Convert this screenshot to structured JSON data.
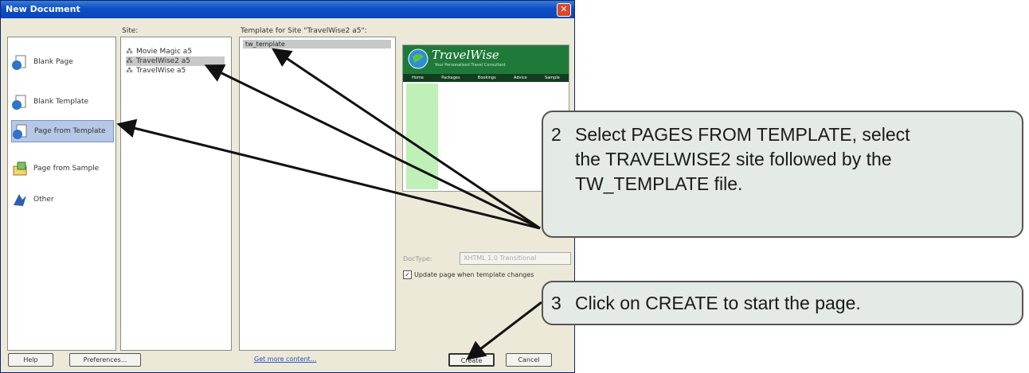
{
  "dialog": {
    "title": "New Document",
    "categories": [
      {
        "label": "Blank Page",
        "icon": "blank-page-icon",
        "selected": false
      },
      {
        "label": "Blank Template",
        "icon": "blank-template-icon",
        "selected": false
      },
      {
        "label": "Page from Template",
        "icon": "page-from-template-icon",
        "selected": true
      },
      {
        "label": "Page from Sample",
        "icon": "page-from-sample-icon",
        "selected": false
      },
      {
        "label": "Other",
        "icon": "other-icon",
        "selected": false
      }
    ],
    "site_label": "Site:",
    "sites": [
      {
        "label": "Movie Magic a5",
        "selected": false
      },
      {
        "label": "TravelWise2 a5",
        "selected": true
      },
      {
        "label": "TravelWise a5",
        "selected": false
      }
    ],
    "template_label": "Template for Site \"TravelWise2 a5\":",
    "templates": [
      {
        "label": "tw_template",
        "selected": true
      }
    ],
    "preview": {
      "logo": "TravelWise",
      "tagline": "Your Personalised Travel Consultant",
      "nav": [
        "Home",
        "Packages",
        "Bookings",
        "Advice",
        "Sample"
      ]
    },
    "doctype_label": "DocType:",
    "doctype_value": "XHTML 1.0 Transitional",
    "update_checkbox": {
      "label": "Update page when template changes",
      "checked": true
    },
    "buttons": {
      "help": "Help",
      "preferences": "Preferences...",
      "create": "Create",
      "cancel": "Cancel"
    },
    "more_content_link": "Get more content..."
  },
  "callouts": [
    {
      "number": "2",
      "lines": [
        "Select PAGES FROM TEMPLATE, select",
        "the TRAVELWISE2 site followed by the",
        "TW_TEMPLATE file."
      ]
    },
    {
      "number": "3",
      "lines": [
        "Click on CREATE to start the page."
      ]
    }
  ],
  "colors": {
    "titlebar": "#0b4fc7",
    "dialog_bg": "#ece9d8",
    "callout_bg": "#e4eae6",
    "preview_green": "#1f7a3a"
  }
}
